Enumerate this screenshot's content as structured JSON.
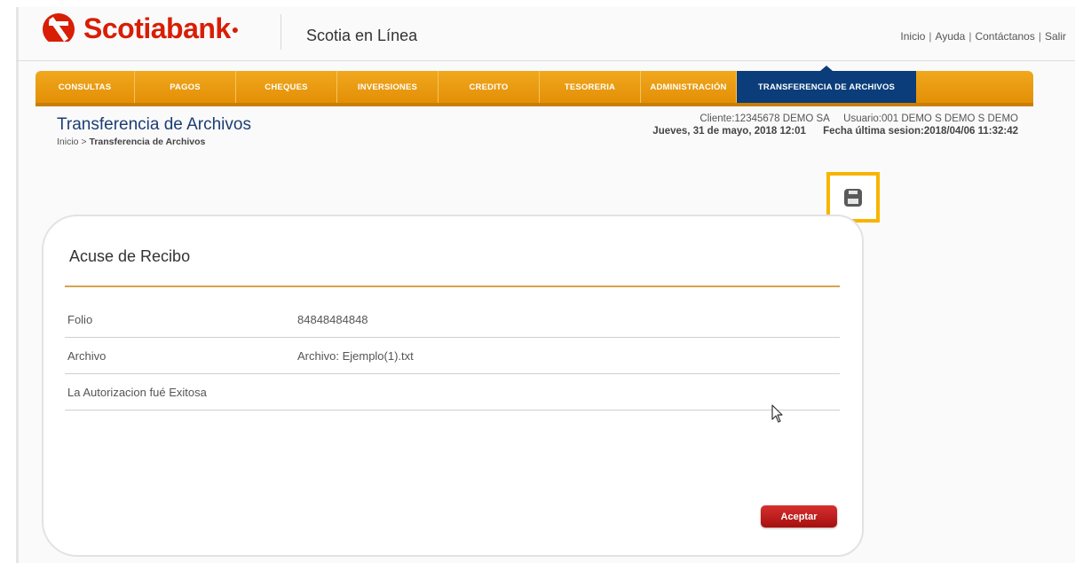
{
  "brand": {
    "name": "Scotiabank",
    "product": "Scotia en Línea"
  },
  "toplinks": [
    "Inicio",
    "Ayuda",
    "Contáctanos",
    "Salir"
  ],
  "nav": [
    {
      "label": "CONSULTAS"
    },
    {
      "label": "PAGOS"
    },
    {
      "label": "CHEQUES"
    },
    {
      "label": "INVERSIONES"
    },
    {
      "label": "CREDITO"
    },
    {
      "label": "TESORERIA"
    },
    {
      "label": "ADMINISTRACIÓN"
    },
    {
      "label": "TRANSFERENCIA DE ARCHIVOS",
      "active": true
    }
  ],
  "page": {
    "title": "Transferencia de Archivos",
    "breadcrumb_home": "Inicio",
    "breadcrumb_sep": " > ",
    "breadcrumb_current": "Transferencia de Archivos"
  },
  "client": {
    "cliente": "Cliente:12345678 DEMO SA",
    "usuario": "Usuario:001 DEMO S DEMO S DEMO",
    "fecha": "Jueves, 31 de mayo, 2018 12:01",
    "ultima_sesion": "Fecha última sesion:2018/04/06 11:32:42"
  },
  "panel": {
    "title": "Acuse de Recibo",
    "rows": [
      {
        "label": "Folio",
        "value": "84848484848"
      },
      {
        "label": "Archivo",
        "value": "Archivo: Ejemplo(1).txt"
      },
      {
        "label": "La Autorizacion fué Exitosa",
        "value": ""
      }
    ],
    "accept_label": "Aceptar"
  },
  "colors": {
    "brand_red": "#d81e05",
    "nav_orange": "#f0a81e",
    "nav_active": "#0a3d7a",
    "highlight": "#f8b400",
    "title_blue": "#1d3e73"
  },
  "icons": {
    "print": "print-icon",
    "cursor": "mouse-pointer-icon"
  }
}
